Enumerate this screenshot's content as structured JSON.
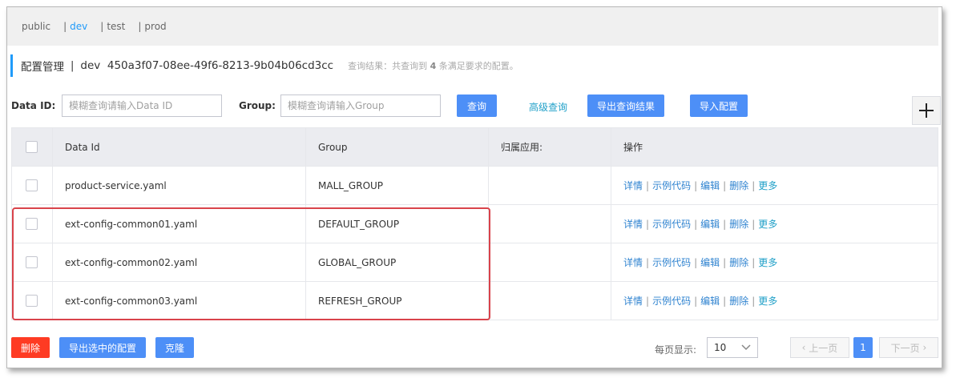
{
  "namespaces": [
    {
      "sep": "",
      "label": "public"
    },
    {
      "sep": "|",
      "label": "dev"
    },
    {
      "sep": "|",
      "label": "test"
    },
    {
      "sep": "|",
      "label": "prod"
    }
  ],
  "active_namespace": "dev",
  "title": {
    "main": "配置管理",
    "sep": "|",
    "namespace": "dev",
    "namespace_id": "450a3f07-08ee-49f6-8213-9b04b06cd3cc",
    "result_prefix": "查询结果：共查询到",
    "result_count": "4",
    "result_suffix": "条满足要求的配置。"
  },
  "search": {
    "data_id_label": "Data ID:",
    "data_id_placeholder": "模糊查询请输入Data ID",
    "group_label": "Group:",
    "group_placeholder": "模糊查询请输入Group",
    "query_button": "查询",
    "advanced_link": "高级查询",
    "export_results_button": "导出查询结果",
    "import_button": "导入配置"
  },
  "table": {
    "headers": [
      "Data Id",
      "Group",
      "归属应用:",
      "操作"
    ],
    "rows": [
      {
        "data_id": "product-service.yaml",
        "group": "MALL_GROUP",
        "app": ""
      },
      {
        "data_id": "ext-config-common01.yaml",
        "group": "DEFAULT_GROUP",
        "app": ""
      },
      {
        "data_id": "ext-config-common02.yaml",
        "group": "GLOBAL_GROUP",
        "app": ""
      },
      {
        "data_id": "ext-config-common03.yaml",
        "group": "REFRESH_GROUP",
        "app": ""
      }
    ],
    "actions": {
      "detail": "详情",
      "sample": "示例代码",
      "edit": "编辑",
      "delete": "删除",
      "more": "更多"
    }
  },
  "footer": {
    "delete_button": "删除",
    "export_selected_button": "导出选中的配置",
    "clone_button": "克隆",
    "page_size_label": "每页显示:",
    "page_size": "10",
    "prev_button": "上一页",
    "current_page": "1",
    "next_button": "下一页"
  },
  "colors": {
    "accent": "#209bfa",
    "button_blue": "#4d8ff7",
    "danger": "#fe3b23",
    "highlight_box": "#d9434b"
  }
}
